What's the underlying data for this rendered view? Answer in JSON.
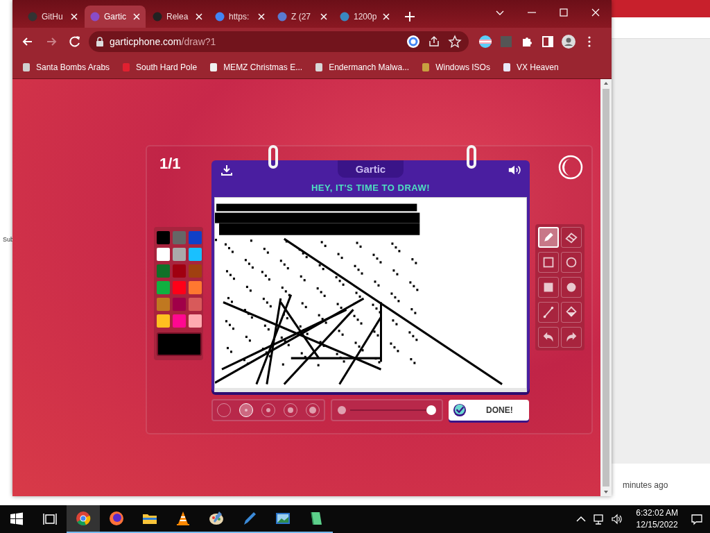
{
  "browser": {
    "tabs": [
      {
        "title": "GitHu",
        "selected": false
      },
      {
        "title": "Gartic",
        "selected": true
      },
      {
        "title": "Relea",
        "selected": false
      },
      {
        "title": "https:",
        "selected": false
      },
      {
        "title": "Z (27",
        "selected": false
      },
      {
        "title": "1200p",
        "selected": false
      }
    ],
    "address": {
      "host": "garticphone.com",
      "path": "/draw?1"
    },
    "bookmarks": [
      "Santa Bombs Arabs",
      "South Hard Pole",
      "MEMZ Christmas E...",
      "Endermanch Malwa...",
      "Windows ISOs",
      "VX Heaven"
    ]
  },
  "game": {
    "round": "1/1",
    "logo": "Gartic",
    "heading": "HEY, IT'S TIME TO DRAW!",
    "palette": [
      {
        "color": "#000000",
        "selected": false
      },
      {
        "color": "#666666",
        "selected": false
      },
      {
        "color": "#1040c8",
        "selected": false
      },
      {
        "color": "#ffffff",
        "selected": false
      },
      {
        "color": "#aaaaaa",
        "selected": false
      },
      {
        "color": "#19c0ff",
        "selected": false
      },
      {
        "color": "#107028",
        "selected": false
      },
      {
        "color": "#a00010",
        "selected": false
      },
      {
        "color": "#a04010",
        "selected": false
      },
      {
        "color": "#10b040",
        "selected": false
      },
      {
        "color": "#ff0018",
        "selected": false
      },
      {
        "color": "#ff7830",
        "selected": false
      },
      {
        "color": "#c07820",
        "selected": false
      },
      {
        "color": "#a00048",
        "selected": false
      },
      {
        "color": "#d85a5a",
        "selected": false
      },
      {
        "color": "#ffc020",
        "selected": false
      },
      {
        "color": "#ff0890",
        "selected": false
      },
      {
        "color": "#ffaab0",
        "selected": false
      }
    ],
    "current": {
      "color": "#000000"
    },
    "tools": [
      {
        "kind": "pencil",
        "selected": true
      },
      {
        "kind": "eraser",
        "selected": false
      },
      {
        "kind": "rect",
        "selected": false
      },
      {
        "kind": "ellipse",
        "selected": false
      },
      {
        "kind": "filled-rect",
        "selected": false
      },
      {
        "kind": "filled-ellipse",
        "selected": false
      },
      {
        "kind": "line",
        "selected": false
      },
      {
        "kind": "bucket",
        "selected": false
      },
      {
        "kind": "undo",
        "selected": false
      },
      {
        "kind": "redo",
        "selected": false
      }
    ],
    "brush_sizes": [
      {
        "selected": false
      },
      {
        "selected": true
      },
      {
        "selected": false
      },
      {
        "selected": false
      },
      {
        "selected": false
      }
    ],
    "opacity": {
      "level": 1
    },
    "done_button": "DONE!"
  },
  "side_window": {
    "label": "Sub",
    "status": "minutes ago"
  },
  "taskbar": {
    "apps": [
      {
        "kind": "chrome",
        "selected": true
      },
      {
        "kind": "firefox",
        "selected": false
      },
      {
        "kind": "folder",
        "selected": false
      },
      {
        "kind": "cone",
        "selected": false
      },
      {
        "kind": "palette",
        "selected": false
      },
      {
        "kind": "pen",
        "selected": false
      },
      {
        "kind": "photo",
        "selected": false
      },
      {
        "kind": "notepad",
        "selected": false
      }
    ],
    "time": "6:32:02 AM",
    "date": "12/15/2022"
  }
}
